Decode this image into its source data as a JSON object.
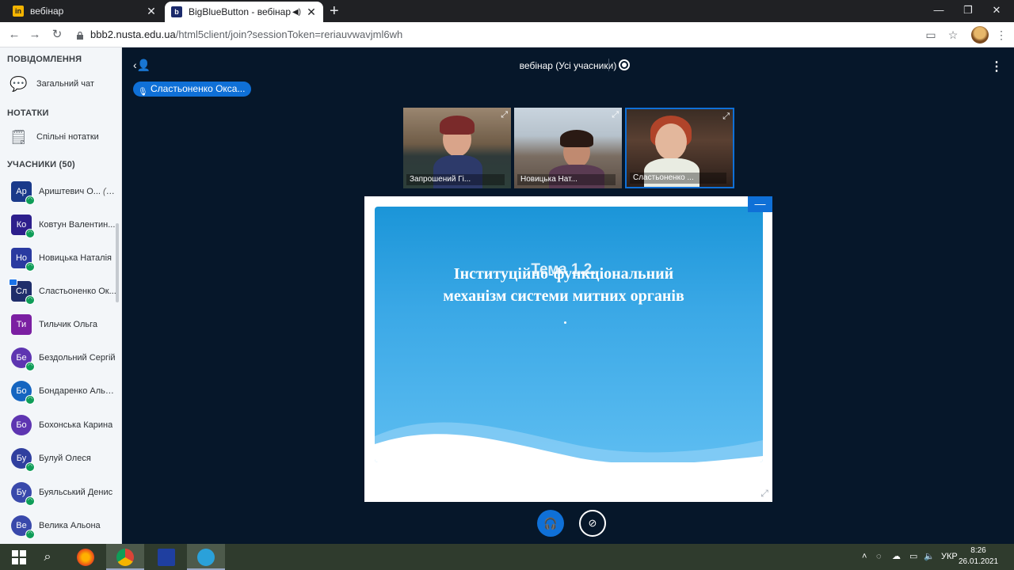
{
  "browser": {
    "tabs": [
      {
        "title": "вебінар",
        "favicon": "in-icon"
      },
      {
        "title": "BigBlueButton - вебінар (Усі",
        "favicon": "bbb-icon"
      }
    ],
    "url_host": "bbb2.nusta.edu.ua",
    "url_path": "/html5client/join?sessionToken=reriauvwavjml6wh"
  },
  "sidebar": {
    "messages_title": "ПОВІДОМЛЕННЯ",
    "public_chat": "Загальний чат",
    "notes_title": "НОТАТКИ",
    "shared_notes": "Спільні нотатки",
    "users_title": "УЧАСНИКИ (50)",
    "users": [
      {
        "initials": "Ар",
        "name": "Ариштевич О...",
        "you": "(Ви)",
        "color": "#1a3a8a"
      },
      {
        "initials": "Ко",
        "name": "Ковтун Валентин...",
        "you": "",
        "color": "#2d1f8c"
      },
      {
        "initials": "Но",
        "name": "Новицька Наталія",
        "you": "",
        "color": "#2a3aa0"
      },
      {
        "initials": "Сл",
        "name": "Сластьоненко Ок...",
        "you": "",
        "color": "#1f2e6b"
      },
      {
        "initials": "Ти",
        "name": "Тильчик Ольга",
        "you": "",
        "color": "#7b1fa2"
      },
      {
        "initials": "Бе",
        "name": "Бездольний Сергій",
        "you": "",
        "color": "#5e35b1"
      },
      {
        "initials": "Бо",
        "name": "Бондаренко Альб...",
        "you": "",
        "color": "#1565c0"
      },
      {
        "initials": "Бо",
        "name": "Бохонська Карина",
        "you": "",
        "color": "#5e35b1"
      },
      {
        "initials": "Бу",
        "name": "Булуй Олеся",
        "you": "",
        "color": "#303f9f"
      },
      {
        "initials": "Бу",
        "name": "Буяльський Денис",
        "you": "",
        "color": "#3949ab"
      },
      {
        "initials": "Ве",
        "name": "Велика Альона",
        "you": "",
        "color": "#3949ab"
      }
    ]
  },
  "main": {
    "meeting_title": "вебінар (Усі учасники)",
    "talking": "Сластьоненко Окса...",
    "videos": [
      {
        "name": "Запрошений Гі..."
      },
      {
        "name": "Новицька Нат..."
      },
      {
        "name": "Сластьоненко ..."
      }
    ],
    "slide_title_line1": "Інституційно-функціональний",
    "slide_title_line2": "механізм системи митних органів",
    "slide_overlay": "Тема 1.2.",
    "minimize_label": "—"
  },
  "taskbar": {
    "lang": "УКР",
    "time": "8:26",
    "date": "26.01.2021"
  },
  "colors": {
    "main_bg": "#06172a",
    "accent": "#0f70d7",
    "sidebar_bg": "#f3f6f9"
  }
}
